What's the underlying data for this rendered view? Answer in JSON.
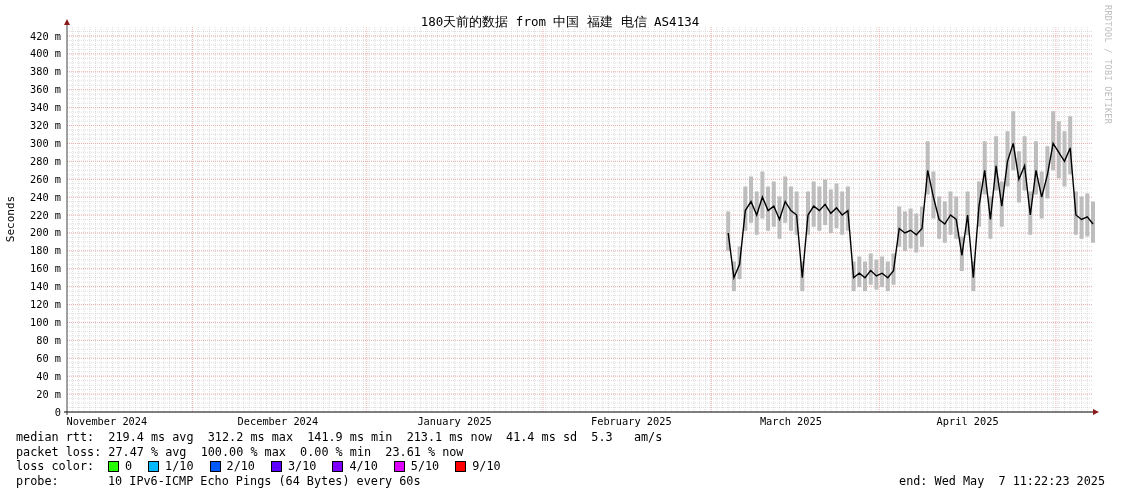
{
  "chart": {
    "title": "180天前的数据 from 中国 福建 电信 AS4134",
    "credit": "RRDTOOL / TOBI OETIKER",
    "chart_data": {
      "type": "line",
      "ylabel": "Seconds",
      "ylim": [
        0,
        430
      ],
      "grid": true,
      "categories": [
        null,
        null,
        null,
        null,
        null,
        null,
        null,
        "November 2024",
        null,
        null,
        null,
        null,
        null,
        null,
        null,
        null,
        null,
        null,
        null,
        null,
        null,
        null,
        null,
        null,
        null,
        null,
        null,
        null,
        null,
        null,
        null,
        null,
        null,
        null,
        null,
        null,
        null,
        "December 2024",
        null,
        null,
        null,
        null,
        null,
        null,
        null,
        null,
        null,
        null,
        null,
        null,
        null,
        null,
        null,
        null,
        null,
        null,
        null,
        null,
        null,
        null,
        null,
        null,
        null,
        null,
        null,
        null,
        null,
        null,
        "January 2025",
        null,
        null,
        null,
        null,
        null,
        null,
        null,
        null,
        null,
        null,
        null,
        null,
        null,
        null,
        null,
        null,
        null,
        null,
        null,
        null,
        null,
        null,
        null,
        null,
        null,
        null,
        null,
        null,
        null,
        null,
        "February 2025",
        null,
        null,
        null,
        null,
        null,
        null,
        null,
        null,
        null,
        null,
        null,
        null,
        null,
        null,
        null,
        null,
        null,
        null,
        null,
        null,
        null,
        null,
        null,
        null,
        null,
        null,
        null,
        "March 2025",
        null,
        null,
        null,
        null,
        null,
        null,
        null,
        null,
        null,
        null,
        null,
        null,
        null,
        null,
        null,
        null,
        null,
        null,
        null,
        null,
        null,
        null,
        null,
        null,
        null,
        null,
        null,
        null,
        null,
        null,
        "April 2025",
        null,
        null,
        null,
        null,
        null,
        null,
        null,
        null,
        null,
        null,
        null,
        null,
        null,
        null,
        null,
        null,
        null,
        null,
        null,
        null,
        null,
        null
      ],
      "yticks": [
        {
          "value": 0,
          "label": "0"
        },
        {
          "value": 20,
          "label": "20 m"
        },
        {
          "value": 40,
          "label": "40 m"
        },
        {
          "value": 60,
          "label": "60 m"
        },
        {
          "value": 80,
          "label": "80 m"
        },
        {
          "value": 100,
          "label": "100 m"
        },
        {
          "value": 120,
          "label": "120 m"
        },
        {
          "value": 140,
          "label": "140 m"
        },
        {
          "value": 160,
          "label": "160 m"
        },
        {
          "value": 180,
          "label": "180 m"
        },
        {
          "value": 200,
          "label": "200 m"
        },
        {
          "value": 220,
          "label": "220 m"
        },
        {
          "value": 240,
          "label": "240 m"
        },
        {
          "value": 260,
          "label": "260 m"
        },
        {
          "value": 280,
          "label": "280 m"
        },
        {
          "value": 300,
          "label": "300 m"
        },
        {
          "value": 320,
          "label": "320 m"
        },
        {
          "value": 340,
          "label": "340 m"
        },
        {
          "value": 360,
          "label": "360 m"
        },
        {
          "value": 380,
          "label": "380 m"
        },
        {
          "value": 400,
          "label": "400 m"
        },
        {
          "value": 420,
          "label": "420 m"
        }
      ],
      "series": [
        {
          "color": "#000000",
          "values": [
            null,
            null,
            null,
            null,
            null,
            null,
            null,
            null,
            null,
            null,
            null,
            null,
            null,
            null,
            null,
            null,
            null,
            null,
            null,
            null,
            null,
            null,
            null,
            null,
            null,
            null,
            null,
            null,
            null,
            null,
            null,
            null,
            null,
            null,
            null,
            null,
            null,
            null,
            null,
            null,
            null,
            null,
            null,
            null,
            null,
            null,
            null,
            null,
            null,
            null,
            null,
            null,
            null,
            null,
            null,
            null,
            null,
            null,
            null,
            null,
            null,
            null,
            null,
            null,
            null,
            null,
            null,
            null,
            null,
            null,
            null,
            null,
            null,
            null,
            null,
            null,
            null,
            null,
            null,
            null,
            null,
            null,
            null,
            null,
            null,
            null,
            null,
            null,
            null,
            null,
            null,
            null,
            null,
            null,
            null,
            null,
            null,
            null,
            null,
            null,
            null,
            null,
            null,
            null,
            null,
            null,
            null,
            null,
            null,
            null,
            null,
            null,
            null,
            null,
            null,
            null,
            200,
            150,
            165,
            225,
            235,
            220,
            240,
            225,
            230,
            215,
            235,
            225,
            220,
            150,
            220,
            230,
            225,
            232,
            222,
            228,
            220,
            225,
            150,
            155,
            150,
            158,
            152,
            155,
            150,
            158,
            205,
            200,
            203,
            198,
            205,
            270,
            240,
            215,
            210,
            220,
            215,
            175,
            220,
            150,
            230,
            270,
            215,
            275,
            230,
            280,
            300,
            260,
            275,
            220,
            270,
            240,
            265,
            300,
            290,
            280,
            295,
            220,
            215,
            218,
            210
          ]
        }
      ]
    }
  },
  "legend": {
    "median_rtt": "median rtt:  219.4 ms avg  312.2 ms max  141.9 ms min  213.1 ms now  41.4 ms sd  5.3   am/s",
    "packet_loss": "packet loss: 27.47 % avg  100.00 % max  0.00 % min  23.61 % now",
    "loss_color_label": "loss color:",
    "loss_colors": [
      {
        "label": "0",
        "color": "#26ff00"
      },
      {
        "label": "1/10",
        "color": "#00b8ff"
      },
      {
        "label": "2/10",
        "color": "#0059ff"
      },
      {
        "label": "3/10",
        "color": "#5e00ff"
      },
      {
        "label": "4/10",
        "color": "#7e00ff"
      },
      {
        "label": "5/10",
        "color": "#dd00ff"
      },
      {
        "label": "9/10",
        "color": "#ff0000"
      }
    ],
    "probe_label": "probe:",
    "probe": "10 IPv6-ICMP Echo Pings (64 Bytes) every 60s",
    "end": "end: Wed May  7 11:22:23 2025"
  }
}
